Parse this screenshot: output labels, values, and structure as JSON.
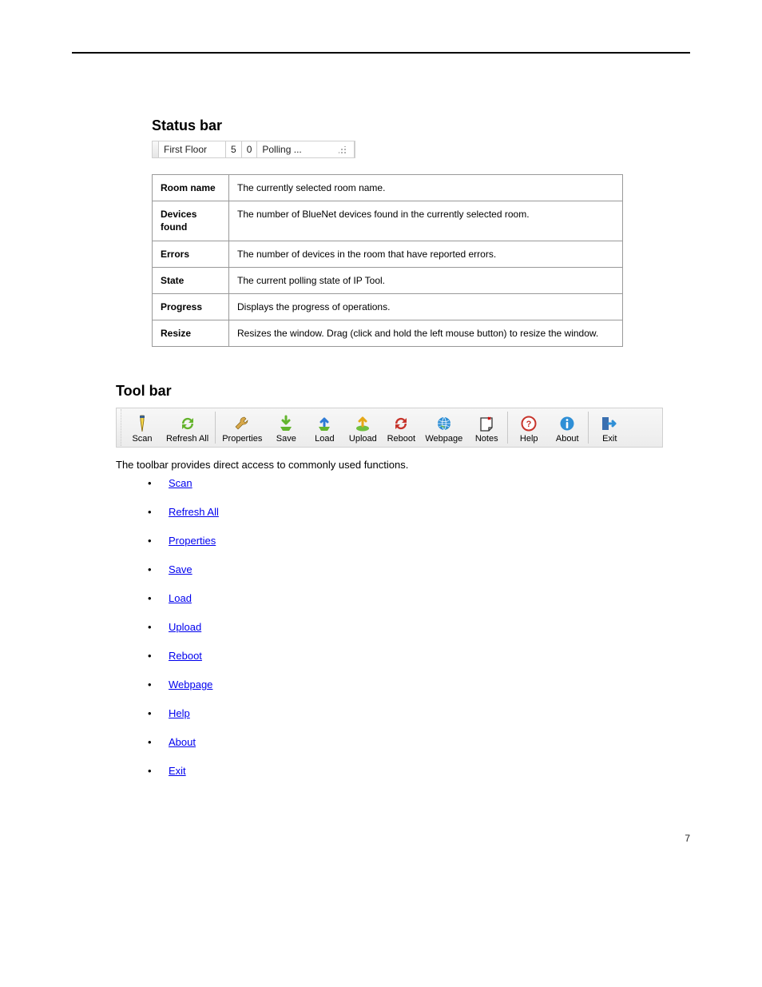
{
  "statusbar": {
    "title": "Status bar",
    "room": "First Floor",
    "val1": "5",
    "val2": "0",
    "state": "Polling ..."
  },
  "info_rows": [
    {
      "k": "Room name",
      "v": "The currently selected room name."
    },
    {
      "k": "Devices found",
      "v": "The number of BlueNet devices found in the currently selected room."
    },
    {
      "k": "Errors",
      "v": "The number of devices in the room that have reported errors."
    },
    {
      "k": "State",
      "v": "The current polling state of IP Tool."
    },
    {
      "k": "Progress",
      "v": "Displays the progress of operations."
    },
    {
      "k": "Resize",
      "v": "Resizes the window. Drag (click and hold the left mouse button) to resize the window."
    }
  ],
  "toolbar": {
    "title": "Tool bar",
    "buttons": [
      {
        "name": "scan-button",
        "label": "Scan"
      },
      {
        "name": "refresh-all-button",
        "label": "Refresh All"
      },
      {
        "name": "properties-button",
        "label": "Properties"
      },
      {
        "name": "save-button",
        "label": "Save"
      },
      {
        "name": "load-button",
        "label": "Load"
      },
      {
        "name": "upload-button",
        "label": "Upload"
      },
      {
        "name": "reboot-button",
        "label": "Reboot"
      },
      {
        "name": "webpage-button",
        "label": "Webpage"
      },
      {
        "name": "notes-button",
        "label": "Notes"
      },
      {
        "name": "help-button",
        "label": "Help"
      },
      {
        "name": "about-button",
        "label": "About"
      },
      {
        "name": "exit-button",
        "label": "Exit"
      }
    ]
  },
  "para": "The toolbar provides direct access to commonly used functions.",
  "links": [
    {
      "name": "link-scan",
      "label": "Scan"
    },
    {
      "name": "link-refresh-all",
      "label": "Refresh All"
    },
    {
      "name": "link-properties",
      "label": "Properties"
    },
    {
      "name": "link-save",
      "label": "Save"
    },
    {
      "name": "link-load",
      "label": "Load"
    },
    {
      "name": "link-upload",
      "label": "Upload"
    },
    {
      "name": "link-reboot",
      "label": "Reboot"
    },
    {
      "name": "link-webpage",
      "label": "Webpage"
    },
    {
      "name": "link-help",
      "label": "Help"
    },
    {
      "name": "link-about",
      "label": "About"
    },
    {
      "name": "link-exit",
      "label": "Exit"
    }
  ],
  "footer": {
    "left": "",
    "right": "7"
  },
  "icons": {
    "scan": "flashlight-icon",
    "refresh": "refresh-icon",
    "properties": "wrench-icon",
    "save": "download-icon",
    "load": "upload-icon",
    "upload": "upload-cloud-icon",
    "reboot": "cycle-icon",
    "webpage": "globe-icon",
    "notes": "note-icon",
    "help": "help-icon",
    "about": "info-icon",
    "exit": "exit-icon"
  }
}
